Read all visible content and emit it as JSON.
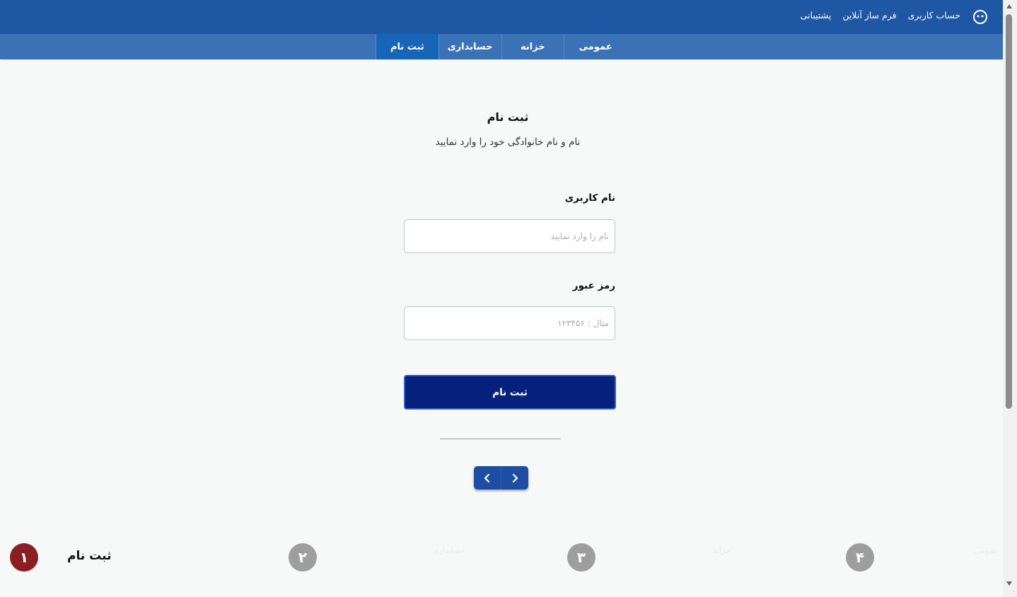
{
  "header": {
    "menu": [
      "حساب کاربری",
      "فرم ساز آنلاین",
      "پشتیبانی"
    ],
    "user_icon": "user-face-icon"
  },
  "tabs": [
    {
      "label": "عمومی",
      "active": false
    },
    {
      "label": "خزانه",
      "active": false
    },
    {
      "label": "حسابداری",
      "active": false
    },
    {
      "label": "ثبت نام",
      "active": true
    }
  ],
  "form": {
    "title": "ثبت نام",
    "subtitle": "نام و نام خانوادگی خود را وارد نمایید",
    "username_label": "نام کاربری",
    "username_placeholder": "نام را وارد نمایید",
    "password_label": "رمز عبور",
    "password_placeholder": "مثال : ۱۲۳۴۵۶",
    "submit_label": "ثبت نام"
  },
  "pager": {
    "prev_icon": "chevron-left-icon",
    "next_icon": "chevron-right-icon"
  },
  "steps": [
    {
      "number": "۱",
      "label": "ثبت نام",
      "active": true
    },
    {
      "number": "۲",
      "label": "حسابداری",
      "active": false
    },
    {
      "number": "۳",
      "label": "خزانه",
      "active": false
    },
    {
      "number": "۴",
      "label": "عمومی",
      "active": false
    }
  ],
  "colors": {
    "header_bg": "#1e57a4",
    "tabbar_bg": "#3b72b6",
    "active_tab": "#1765b6",
    "submit_bg": "#06217c",
    "active_step": "#8b1e23",
    "inactive_step": "#9e9e9e"
  }
}
